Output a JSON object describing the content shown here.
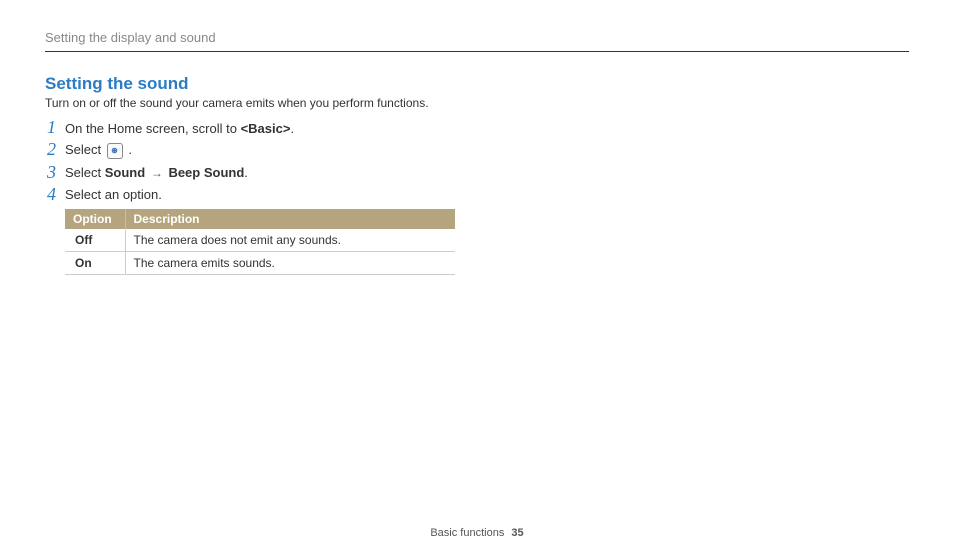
{
  "breadcrumb": "Setting the display and sound",
  "section": {
    "title": "Setting the sound",
    "description": "Turn on or off the sound your camera emits when you perform functions."
  },
  "steps": {
    "s1": {
      "num": "1",
      "pre": "On the Home screen, scroll to ",
      "bold": "<Basic>",
      "post": "."
    },
    "s2": {
      "num": "2",
      "pre": "Select ",
      "post": "."
    },
    "s3": {
      "num": "3",
      "pre": "Select ",
      "bold1": "Sound",
      "arrow": "→",
      "bold2": "Beep Sound",
      "post": "."
    },
    "s4": {
      "num": "4",
      "text": "Select an option."
    }
  },
  "table": {
    "headers": {
      "option": "Option",
      "description": "Description"
    },
    "rows": [
      {
        "option": "Off",
        "description": "The camera does not emit any sounds."
      },
      {
        "option": "On",
        "description": "The camera emits sounds."
      }
    ]
  },
  "footer": {
    "section": "Basic functions",
    "page": "35"
  },
  "icons": {
    "gear": "settings-icon"
  }
}
